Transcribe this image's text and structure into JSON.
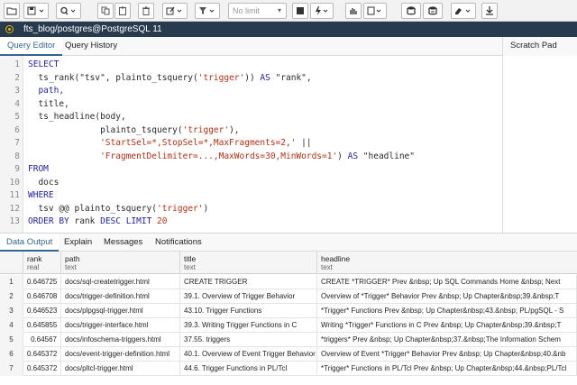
{
  "toolbar": {
    "limit_placeholder": "No limit",
    "icons": [
      "folder-open-icon",
      "save-icon",
      "find-icon",
      "copy-icon",
      "paste-icon",
      "delete-icon",
      "edit-icon",
      "filter-icon",
      "stop-icon",
      "execute-icon",
      "explain-icon",
      "explain-analyze-icon",
      "commit-icon",
      "rollback-icon",
      "clear-icon",
      "download-icon"
    ]
  },
  "connection": {
    "label": "fts_blog/postgres@PostgreSQL 11",
    "status_color": "#e8b400"
  },
  "editor_tabs": [
    "Query Editor",
    "Query History"
  ],
  "scratch_pad": "Scratch Pad",
  "code_lines": [
    {
      "n": "1",
      "parts": [
        {
          "c": "kw",
          "t": "SELECT"
        }
      ]
    },
    {
      "n": "2",
      "parts": [
        {
          "c": "fn",
          "t": "  ts_rank(\"tsv\", plainto_tsquery("
        },
        {
          "c": "str",
          "t": "'trigger'"
        },
        {
          "c": "fn",
          "t": ")) "
        },
        {
          "c": "kw",
          "t": "AS"
        },
        {
          "c": "fn",
          "t": " \"rank\","
        }
      ]
    },
    {
      "n": "3",
      "parts": [
        {
          "c": "kw",
          "t": "  path"
        },
        {
          "c": "fn",
          "t": ","
        }
      ]
    },
    {
      "n": "4",
      "parts": [
        {
          "c": "fn",
          "t": "  title,"
        }
      ]
    },
    {
      "n": "5",
      "parts": [
        {
          "c": "fn",
          "t": "  ts_headline(body,"
        }
      ]
    },
    {
      "n": "6",
      "parts": [
        {
          "c": "fn",
          "t": "              plainto_tsquery("
        },
        {
          "c": "str",
          "t": "'trigger'"
        },
        {
          "c": "fn",
          "t": "),"
        }
      ]
    },
    {
      "n": "7",
      "parts": [
        {
          "c": "str",
          "t": "              'StartSel=*,StopSel=*,MaxFragments=2,'"
        },
        {
          "c": "fn",
          "t": " ||"
        }
      ]
    },
    {
      "n": "8",
      "parts": [
        {
          "c": "str",
          "t": "              'FragmentDelimiter=...,MaxWords=30,MinWords=1'"
        },
        {
          "c": "fn",
          "t": ") "
        },
        {
          "c": "kw",
          "t": "AS"
        },
        {
          "c": "fn",
          "t": " \"headline\""
        }
      ]
    },
    {
      "n": "9",
      "parts": [
        {
          "c": "kw",
          "t": "FROM"
        }
      ]
    },
    {
      "n": "10",
      "parts": [
        {
          "c": "fn",
          "t": "  docs"
        }
      ]
    },
    {
      "n": "11",
      "parts": [
        {
          "c": "kw",
          "t": "WHERE"
        }
      ]
    },
    {
      "n": "12",
      "parts": [
        {
          "c": "fn",
          "t": "  tsv @@ plainto_tsquery("
        },
        {
          "c": "str",
          "t": "'trigger'"
        },
        {
          "c": "fn",
          "t": ")"
        }
      ]
    },
    {
      "n": "13",
      "parts": [
        {
          "c": "kw",
          "t": "ORDER BY"
        },
        {
          "c": "fn",
          "t": " rank "
        },
        {
          "c": "kw",
          "t": "DESC LIMIT"
        },
        {
          "c": "fn",
          "t": " "
        },
        {
          "c": "str",
          "t": "20"
        }
      ]
    }
  ],
  "result_tabs": [
    "Data Output",
    "Explain",
    "Messages",
    "Notifications"
  ],
  "columns": [
    {
      "name": "rank",
      "type": "real"
    },
    {
      "name": "path",
      "type": "text"
    },
    {
      "name": "title",
      "type": "text"
    },
    {
      "name": "headline",
      "type": "text"
    }
  ],
  "rows": [
    {
      "n": "1",
      "rank": "0.646725",
      "path": "docs/sql-createtrigger.html",
      "title": "CREATE TRIGGER",
      "headline": "CREATE *TRIGGER*    Prev &nbsp;  Up   SQL Commands   Home   &nbsp; Next"
    },
    {
      "n": "2",
      "rank": "0.646708",
      "path": "docs/trigger-definition.html",
      "title": "39.1. Overview of Trigger Behavior",
      "headline": "Overview of *Trigger* Behavior    Prev &nbsp;  Up    Chapter&nbsp;39.&nbsp;T"
    },
    {
      "n": "3",
      "rank": "0.646523",
      "path": "docs/plpgsql-trigger.html",
      "title": "43.10. Trigger Functions",
      "headline": "*Trigger* Functions    Prev &nbsp;  Up    Chapter&nbsp;43.&nbsp; PL/pgSQL - S"
    },
    {
      "n": "4",
      "rank": "0.645855",
      "path": "docs/trigger-interface.html",
      "title": "39.3. Writing Trigger Functions in C",
      "headline": "Writing *Trigger* Functions in C    Prev &nbsp;  Up    Chapter&nbsp;39.&nbsp;T"
    },
    {
      "n": "5",
      "rank": "0.64567",
      "path": "docs/infoschema-triggers.html",
      "title": "37.55. triggers",
      "headline": "*triggers*     Prev &nbsp;  Up    Chapter&nbsp;37.&nbsp;The Information Schem"
    },
    {
      "n": "6",
      "rank": "0.645372",
      "path": "docs/event-trigger-definition.html",
      "title": "40.1. Overview of Event Trigger Behavior",
      "headline": "Overview of Event *Trigger* Behavior    Prev &nbsp;  Up    Chapter&nbsp;40.&nb"
    },
    {
      "n": "7",
      "rank": "0.645372",
      "path": "docs/pltcl-trigger.html",
      "title": "44.6. Trigger Functions in PL/Tcl",
      "headline": "*Trigger* Functions in PL/Tcl    Prev &nbsp;  Up    Chapter&nbsp;44.&nbsp;PL/Tcl"
    }
  ],
  "accent_color": "#326690"
}
